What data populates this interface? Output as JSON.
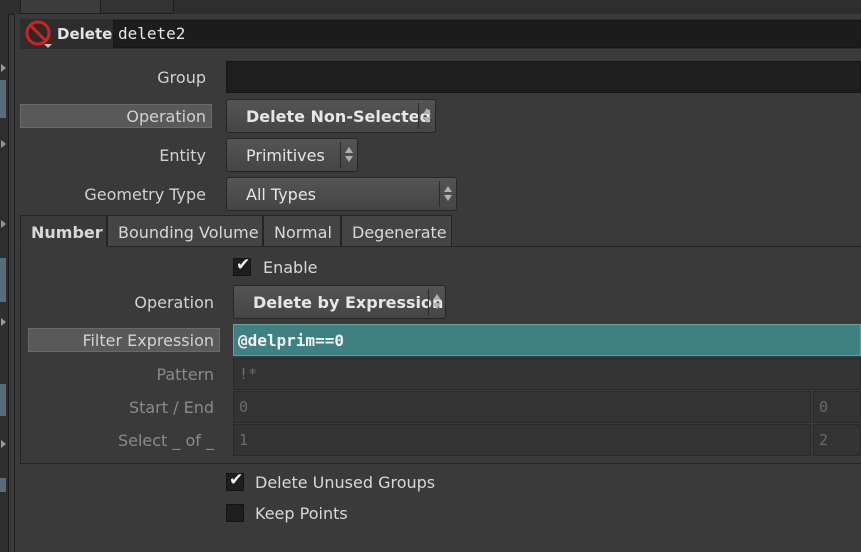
{
  "header": {
    "node_type": "Delete",
    "node_name": "delete2",
    "node_icon": "no-entry-icon"
  },
  "params": {
    "group_label": "Group",
    "group_value": "",
    "operation_label": "Operation",
    "operation_value": "Delete Non-Selected",
    "entity_label": "Entity",
    "entity_value": "Primitives",
    "geometry_type_label": "Geometry Type",
    "geometry_type_value": "All Types"
  },
  "tabs": [
    {
      "label": "Number",
      "active": true
    },
    {
      "label": "Bounding Volume",
      "active": false
    },
    {
      "label": "Normal",
      "active": false
    },
    {
      "label": "Degenerate",
      "active": false
    }
  ],
  "number_tab": {
    "enable_label": "Enable",
    "enable_checked": true,
    "operation_label": "Operation",
    "operation_value": "Delete by Expression",
    "filter_expression_label": "Filter Expression",
    "filter_expression_value": "@delprim==0",
    "pattern_label": "Pattern",
    "pattern_value": "!*",
    "start_end_label": "Start / End",
    "start_value": "0",
    "end_value": "0",
    "select_of_label": "Select _ of _",
    "select_value": "1",
    "of_value": "2"
  },
  "footer": {
    "delete_unused_groups_label": "Delete Unused Groups",
    "delete_unused_groups_checked": true,
    "keep_points_label": "Keep Points",
    "keep_points_checked": false
  },
  "colors": {
    "panel_bg": "#3a3a3a",
    "field_bg": "#1e1e1e",
    "expression_highlight": "#3f8080"
  }
}
